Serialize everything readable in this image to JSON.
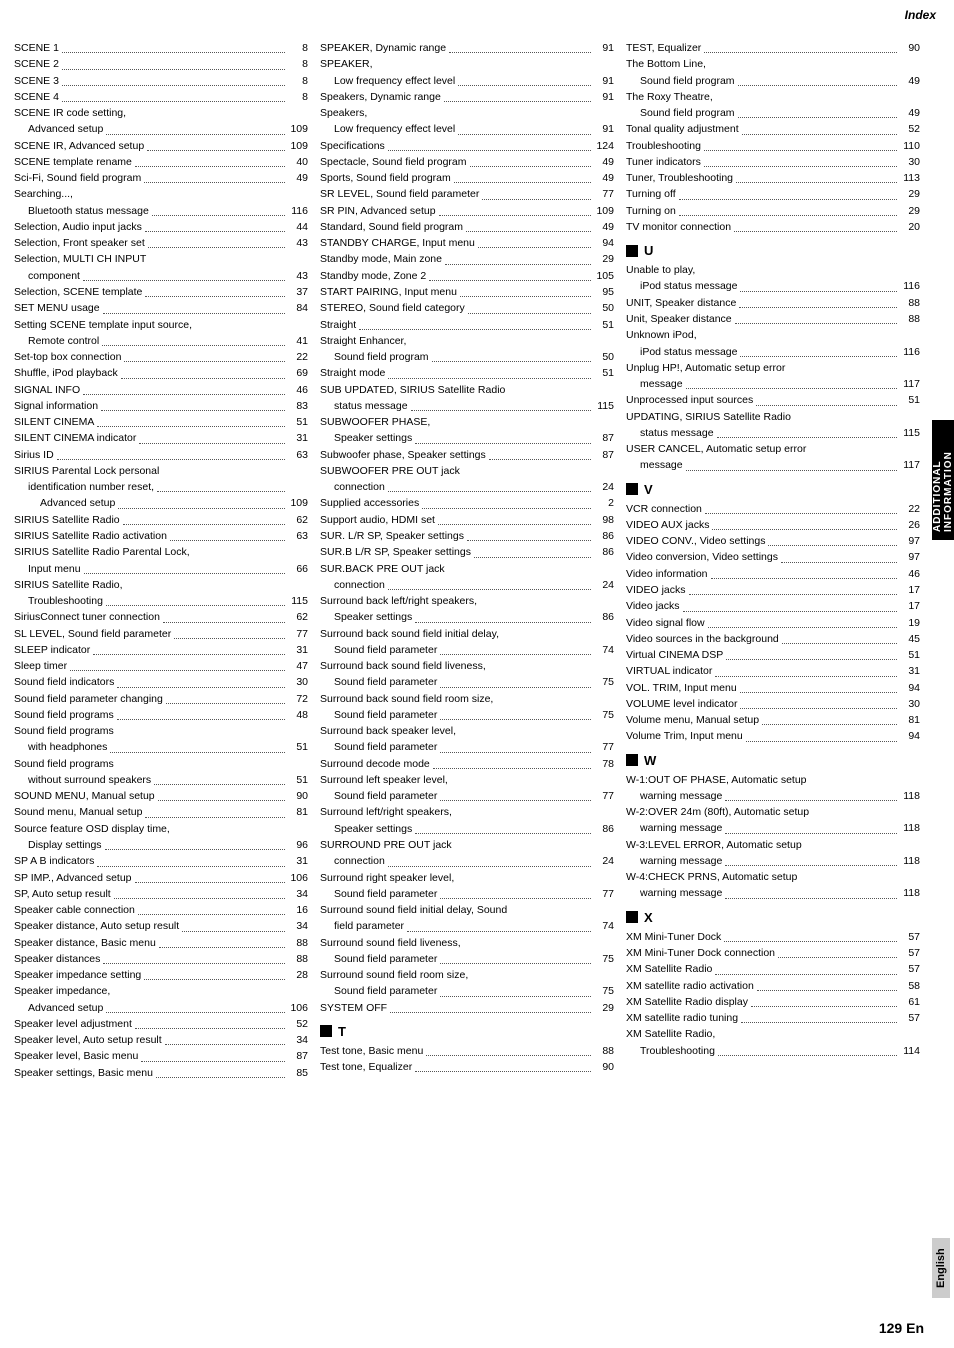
{
  "header": {
    "index_label": "Index"
  },
  "page_number": "129 En",
  "side_tab": "ADDITIONAL INFORMATION",
  "lang": "English",
  "col1": {
    "entries": [
      {
        "text": "SCENE 1",
        "page": "8"
      },
      {
        "text": "SCENE 2",
        "page": "8"
      },
      {
        "text": "SCENE 3",
        "page": "8"
      },
      {
        "text": "SCENE 4",
        "page": "8"
      },
      {
        "text": "SCENE IR code setting,",
        "page": null
      },
      {
        "sub": "Advanced setup",
        "page": "109"
      },
      {
        "text": "SCENE IR, Advanced setup",
        "page": "109"
      },
      {
        "text": "SCENE template rename",
        "page": "40"
      },
      {
        "text": "Sci-Fi, Sound field program",
        "page": "49"
      },
      {
        "text": "Searching...,",
        "page": null
      },
      {
        "sub": "Bluetooth status message",
        "page": "116"
      },
      {
        "text": "Selection, Audio input jacks",
        "page": "44"
      },
      {
        "text": "Selection, Front speaker set",
        "page": "43"
      },
      {
        "text": "Selection, MULTI CH INPUT",
        "page": null
      },
      {
        "sub": "component",
        "page": "43"
      },
      {
        "text": "Selection, SCENE template",
        "page": "37"
      },
      {
        "text": "SET MENU usage",
        "page": "84"
      },
      {
        "text": "Setting SCENE template input source,",
        "page": null
      },
      {
        "sub": "Remote control",
        "page": "41"
      },
      {
        "text": "Set-top box connection",
        "page": "22"
      },
      {
        "text": "Shuffle, iPod playback",
        "page": "69"
      },
      {
        "text": "SIGNAL INFO",
        "page": "46"
      },
      {
        "text": "Signal information",
        "page": "83"
      },
      {
        "text": "SILENT CINEMA",
        "page": "51"
      },
      {
        "text": "SILENT CINEMA indicator",
        "page": "31"
      },
      {
        "text": "Sirius ID",
        "page": "63"
      },
      {
        "text": "SIRIUS Parental Lock personal",
        "page": null
      },
      {
        "sub": "identification number reset,",
        "page": null
      },
      {
        "sub2": "Advanced setup",
        "page": "109"
      },
      {
        "text": "SIRIUS Satellite Radio",
        "page": "62"
      },
      {
        "text": "SIRIUS Satellite Radio activation",
        "page": "63"
      },
      {
        "text": "SIRIUS Satellite Radio Parental Lock,",
        "page": null
      },
      {
        "sub": "Input menu",
        "page": "66"
      },
      {
        "text": "SIRIUS Satellite Radio,",
        "page": null
      },
      {
        "sub": "Troubleshooting",
        "page": "115"
      },
      {
        "text": "SiriusConnect tuner connection",
        "page": "62"
      },
      {
        "text": "SL LEVEL, Sound field parameter",
        "page": "77"
      },
      {
        "text": "SLEEP indicator",
        "page": "31"
      },
      {
        "text": "Sleep timer",
        "page": "47"
      },
      {
        "text": "Sound field indicators",
        "page": "30"
      },
      {
        "text": "Sound field parameter changing",
        "page": "72"
      },
      {
        "text": "Sound field programs",
        "page": "48"
      },
      {
        "text": "Sound field programs",
        "page": null
      },
      {
        "sub": "with headphones",
        "page": "51"
      },
      {
        "text": "Sound field programs",
        "page": null
      },
      {
        "sub": "without surround speakers",
        "page": "51"
      },
      {
        "text": "SOUND MENU, Manual setup",
        "page": "90"
      },
      {
        "text": "Sound menu, Manual setup",
        "page": "81"
      },
      {
        "text": "Source feature OSD display time,",
        "page": null
      },
      {
        "sub": "Display settings",
        "page": "96"
      },
      {
        "text": "SP A B indicators",
        "page": "31"
      },
      {
        "text": "SP IMP., Advanced setup",
        "page": "106"
      },
      {
        "text": "SP, Auto setup result",
        "page": "34"
      },
      {
        "text": "Speaker cable connection",
        "page": "16"
      },
      {
        "text": "Speaker distance, Auto setup result",
        "page": "34"
      },
      {
        "text": "Speaker distance, Basic menu",
        "page": "88"
      },
      {
        "text": "Speaker distances",
        "page": "88"
      },
      {
        "text": "Speaker impedance setting",
        "page": "28"
      },
      {
        "text": "Speaker impedance,",
        "page": null
      },
      {
        "sub": "Advanced setup",
        "page": "106"
      },
      {
        "text": "Speaker level adjustment",
        "page": "52"
      },
      {
        "text": "Speaker level, Auto setup result",
        "page": "34"
      },
      {
        "text": "Speaker level, Basic menu",
        "page": "87"
      },
      {
        "text": "Speaker settings, Basic menu",
        "page": "85"
      }
    ]
  },
  "col2": {
    "entries": [
      {
        "text": "SPEAKER, Dynamic range",
        "page": "91"
      },
      {
        "text": "SPEAKER,",
        "page": null
      },
      {
        "sub": "Low frequency effect level",
        "page": "91"
      },
      {
        "text": "Speakers, Dynamic range",
        "page": "91"
      },
      {
        "text": "Speakers,",
        "page": null
      },
      {
        "sub": "Low frequency effect level",
        "page": "91"
      },
      {
        "text": "Specifications",
        "page": "124"
      },
      {
        "text": "Spectacle, Sound field program",
        "page": "49"
      },
      {
        "text": "Sports, Sound field program",
        "page": "49"
      },
      {
        "text": "SR LEVEL, Sound field parameter",
        "page": "77"
      },
      {
        "text": "SR PIN, Advanced setup",
        "page": "109"
      },
      {
        "text": "Standard, Sound field program",
        "page": "49"
      },
      {
        "text": "STANDBY CHARGE, Input menu",
        "page": "94"
      },
      {
        "text": "Standby mode, Main zone",
        "page": "29"
      },
      {
        "text": "Standby mode, Zone 2",
        "page": "105"
      },
      {
        "text": "START PAIRING, Input menu",
        "page": "95"
      },
      {
        "text": "STEREO, Sound field category",
        "page": "50"
      },
      {
        "text": "Straight",
        "page": "51"
      },
      {
        "text": "Straight Enhancer,",
        "page": null
      },
      {
        "sub": "Sound field program",
        "page": "50"
      },
      {
        "text": "Straight mode",
        "page": "51"
      },
      {
        "text": "SUB UPDATED, SIRIUS Satellite Radio",
        "page": null
      },
      {
        "sub": "status message",
        "page": "115"
      },
      {
        "text": "SUBWOOFER PHASE,",
        "page": null
      },
      {
        "sub": "Speaker settings",
        "page": "87"
      },
      {
        "text": "Subwoofer phase, Speaker settings",
        "page": "87"
      },
      {
        "text": "SUBWOOFER PRE OUT jack",
        "page": null
      },
      {
        "sub": "connection",
        "page": "24"
      },
      {
        "text": "Supplied accessories",
        "page": "2"
      },
      {
        "text": "Support audio, HDMI set",
        "page": "98"
      },
      {
        "text": "SUR. L/R SP, Speaker settings",
        "page": "86"
      },
      {
        "text": "SUR.B L/R SP, Speaker settings",
        "page": "86"
      },
      {
        "text": "SUR.BACK PRE OUT jack",
        "page": null
      },
      {
        "sub": "connection",
        "page": "24"
      },
      {
        "text": "Surround back left/right speakers,",
        "page": null
      },
      {
        "sub": "Speaker settings",
        "page": "86"
      },
      {
        "text": "Surround back sound field initial delay,",
        "page": null
      },
      {
        "sub": "Sound field parameter",
        "page": "74"
      },
      {
        "text": "Surround back sound field liveness,",
        "page": null
      },
      {
        "sub": "Sound field parameter",
        "page": "75"
      },
      {
        "text": "Surround back sound field room size,",
        "page": null
      },
      {
        "sub": "Sound field parameter",
        "page": "75"
      },
      {
        "text": "Surround back speaker level,",
        "page": null
      },
      {
        "sub": "Sound field parameter",
        "page": "77"
      },
      {
        "text": "Surround decode mode",
        "page": "78"
      },
      {
        "text": "Surround left speaker level,",
        "page": null
      },
      {
        "sub": "Sound field parameter",
        "page": "77"
      },
      {
        "text": "Surround left/right speakers,",
        "page": null
      },
      {
        "sub": "Speaker settings",
        "page": "86"
      },
      {
        "text": "SURROUND PRE OUT jack",
        "page": null
      },
      {
        "sub": "connection",
        "page": "24"
      },
      {
        "text": "Surround right speaker level,",
        "page": null
      },
      {
        "sub": "Sound field parameter",
        "page": "77"
      },
      {
        "text": "Surround sound field initial delay, Sound",
        "page": null
      },
      {
        "sub": "field parameter",
        "page": "74"
      },
      {
        "text": "Surround sound field liveness,",
        "page": null
      },
      {
        "sub": "Sound field parameter",
        "page": "75"
      },
      {
        "text": "Surround sound field room size,",
        "page": null
      },
      {
        "sub": "Sound field parameter",
        "page": "75"
      },
      {
        "text": "SYSTEM OFF",
        "page": "29"
      },
      {
        "section": "T"
      },
      {
        "text": "Test tone, Basic menu",
        "page": "88"
      },
      {
        "text": "Test tone, Equalizer",
        "page": "90"
      }
    ]
  },
  "col3": {
    "entries": [
      {
        "text": "TEST, Equalizer",
        "page": "90"
      },
      {
        "text": "The Bottom Line,",
        "page": null
      },
      {
        "sub": "Sound field program",
        "page": "49"
      },
      {
        "text": "The Roxy Theatre,",
        "page": null
      },
      {
        "sub": "Sound field program",
        "page": "49"
      },
      {
        "text": "Tonal quality adjustment",
        "page": "52"
      },
      {
        "text": "Troubleshooting",
        "page": "110"
      },
      {
        "text": "Tuner indicators",
        "page": "30"
      },
      {
        "text": "Tuner, Troubleshooting",
        "page": "113"
      },
      {
        "text": "Turning off",
        "page": "29"
      },
      {
        "text": "Turning on",
        "page": "29"
      },
      {
        "text": "TV monitor connection",
        "page": "20"
      },
      {
        "section": "U"
      },
      {
        "text": "Unable to play,",
        "page": null
      },
      {
        "sub": "iPod status message",
        "page": "116"
      },
      {
        "text": "UNIT, Speaker distance",
        "page": "88"
      },
      {
        "text": "Unit, Speaker distance",
        "page": "88"
      },
      {
        "text": "Unknown iPod,",
        "page": null
      },
      {
        "sub": "iPod status message",
        "page": "116"
      },
      {
        "text": "Unplug HP!, Automatic setup error",
        "page": null
      },
      {
        "sub": "message",
        "page": "117"
      },
      {
        "text": "Unprocessed input sources",
        "page": "51"
      },
      {
        "text": "UPDATING, SIRIUS Satellite Radio",
        "page": null
      },
      {
        "sub": "status message",
        "page": "115"
      },
      {
        "text": "USER CANCEL, Automatic setup error",
        "page": null
      },
      {
        "sub": "message",
        "page": "117"
      },
      {
        "section": "V"
      },
      {
        "text": "VCR connection",
        "page": "22"
      },
      {
        "text": "VIDEO AUX jacks",
        "page": "26"
      },
      {
        "text": "VIDEO CONV., Video settings",
        "page": "97"
      },
      {
        "text": "Video conversion, Video settings",
        "page": "97"
      },
      {
        "text": "Video information",
        "page": "46"
      },
      {
        "text": "VIDEO jacks",
        "page": "17"
      },
      {
        "text": "Video jacks",
        "page": "17"
      },
      {
        "text": "Video signal flow",
        "page": "19"
      },
      {
        "text": "Video sources in the background",
        "page": "45"
      },
      {
        "text": "Virtual CINEMA DSP",
        "page": "51"
      },
      {
        "text": "VIRTUAL indicator",
        "page": "31"
      },
      {
        "text": "VOL. TRIM, Input menu",
        "page": "94"
      },
      {
        "text": "VOLUME level indicator",
        "page": "30"
      },
      {
        "text": "Volume menu, Manual setup",
        "page": "81"
      },
      {
        "text": "Volume Trim, Input menu",
        "page": "94"
      },
      {
        "section": "W"
      },
      {
        "text": "W-1:OUT OF PHASE, Automatic setup",
        "page": null
      },
      {
        "sub": "warning message",
        "page": "118"
      },
      {
        "text": "W-2:OVER 24m (80ft), Automatic setup",
        "page": null
      },
      {
        "sub": "warning message",
        "page": "118"
      },
      {
        "text": "W-3:LEVEL ERROR, Automatic setup",
        "page": null
      },
      {
        "sub": "warning message",
        "page": "118"
      },
      {
        "text": "W-4:CHECK PRNS, Automatic setup",
        "page": null
      },
      {
        "sub": "warning message",
        "page": "118"
      },
      {
        "section": "X"
      },
      {
        "text": "XM Mini-Tuner Dock",
        "page": "57"
      },
      {
        "text": "XM Mini-Tuner Dock connection",
        "page": "57"
      },
      {
        "text": "XM Satellite Radio",
        "page": "57"
      },
      {
        "text": "XM satellite radio activation",
        "page": "58"
      },
      {
        "text": "XM Satellite Radio display",
        "page": "61"
      },
      {
        "text": "XM satellite radio tuning",
        "page": "57"
      },
      {
        "text": "XM Satellite Radio,",
        "page": null
      },
      {
        "sub": "Troubleshooting",
        "page": "114"
      }
    ]
  }
}
